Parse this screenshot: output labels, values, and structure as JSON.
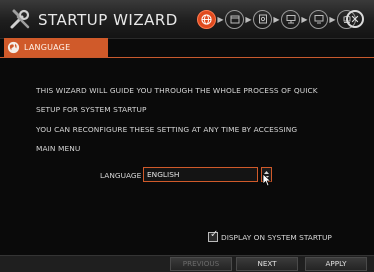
{
  "window": {
    "title": "STARTUP WIZARD",
    "app_icon": "wrench-screwdriver-icon",
    "close_icon": "close-icon"
  },
  "steps": [
    {
      "icon": "globe-icon",
      "active": true
    },
    {
      "icon": "calendar-icon",
      "active": false
    },
    {
      "icon": "disk-icon",
      "active": false
    },
    {
      "icon": "network-icon",
      "active": false
    },
    {
      "icon": "monitor-icon",
      "active": false
    },
    {
      "icon": "camera-icon",
      "active": false
    }
  ],
  "tab": {
    "label": "LANGUAGE",
    "icon": "globe-icon"
  },
  "content": {
    "line1": "THIS WIZARD WILL GUIDE YOU THROUGH THE WHOLE PROCESS OF QUICK",
    "line2": "SETUP FOR SYSTEM STARTUP",
    "line3": "YOU CAN RECONFIGURE THESE SETTING AT ANY TIME BY ACCESSING",
    "line4": "MAIN MENU"
  },
  "language": {
    "label": "LANGUAGE",
    "value": "ENGLISH"
  },
  "display_startup": {
    "label": "DISPLAY ON SYSTEM STARTUP",
    "checked": true
  },
  "footer": {
    "previous": "PREVIOUS",
    "next": "NEXT",
    "apply": "APPLY"
  },
  "colors": {
    "accent": "#d05a2a",
    "background": "#0a0a0a"
  }
}
